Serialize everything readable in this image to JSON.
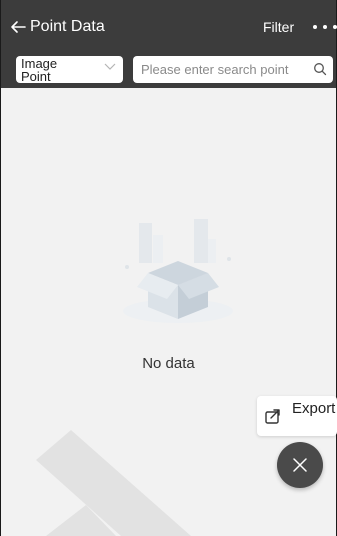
{
  "header": {
    "back_icon": "arrow-left-icon",
    "title": "Point Data",
    "filter_label": "Filter",
    "more_icon": "more-horizontal-icon"
  },
  "toolbar": {
    "type_select": {
      "value": "Image Point",
      "icon": "chevron-down-icon"
    },
    "search": {
      "placeholder": "Please enter search point",
      "value": "",
      "icon": "search-icon"
    }
  },
  "empty_state": {
    "illustration": "empty-box-icon",
    "text": "No data"
  },
  "actions": {
    "export_label": "Export",
    "export_icon": "export-icon",
    "close_icon": "close-icon"
  },
  "colors": {
    "header_bg": "#3c3c3c",
    "page_bg": "#f2f2f2",
    "fab_bg": "#4a4a4a"
  }
}
